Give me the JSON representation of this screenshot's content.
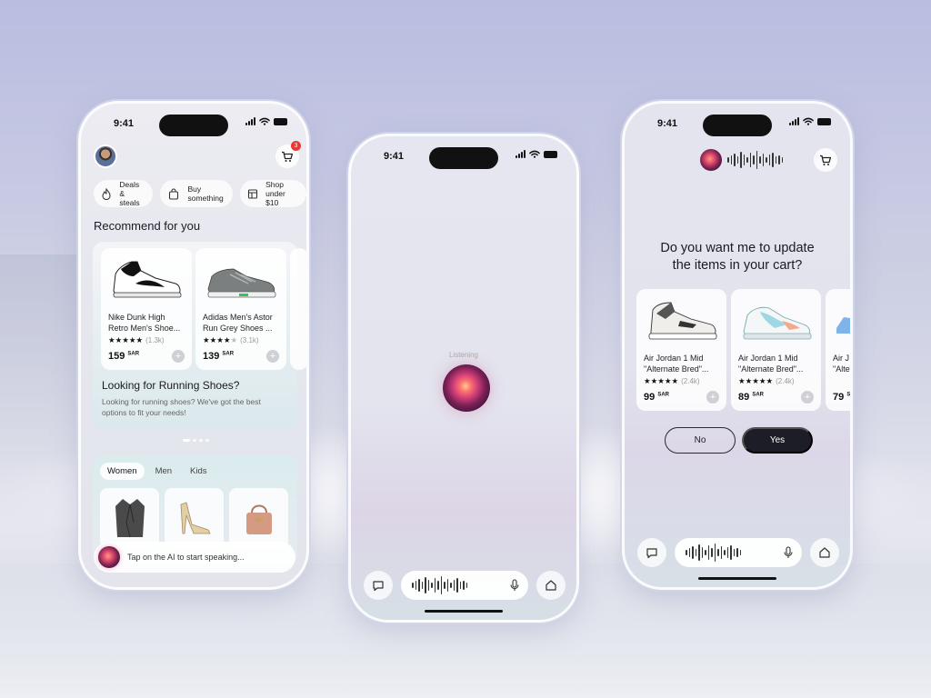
{
  "colors": {
    "accent": "#1c1d26",
    "badge": "#e53935",
    "star": "#111111"
  },
  "status": {
    "time": "9:41"
  },
  "home": {
    "cart_count": "3",
    "chips": [
      {
        "icon": "flame-icon",
        "label": "Deals &\nsteals"
      },
      {
        "icon": "bag-icon",
        "label": "Buy\nsomething"
      },
      {
        "icon": "store-icon",
        "label": "Shop\nunder $10"
      }
    ],
    "section_title": "Recommend for you",
    "products": [
      {
        "name": "Nike Dunk High\nRetro Men's Shoe...",
        "rating_count": "(1.3k)",
        "price": "159",
        "currency": "SAR",
        "rating": 5
      },
      {
        "name": "Adidas Men's Astor\nRun Grey Shoes ...",
        "rating_count": "(3.1k)",
        "price": "139",
        "currency": "SAR",
        "rating": 4
      }
    ],
    "promo_title": "Looking for Running Shoes?",
    "promo_desc": "Looking for running shoes? We've got the best options to fit your needs!",
    "tabs": [
      "Women",
      "Men",
      "Kids"
    ],
    "ai_prompt": "Tap on the AI to start speaking..."
  },
  "listening": {
    "label": "Listening"
  },
  "cart_confirm": {
    "question": "Do you want me to update\nthe items in your cart?",
    "items": [
      {
        "name": "Air Jordan 1 Mid\n\"Alternate Bred\"...",
        "rating_count": "(2.4k)",
        "price": "99",
        "currency": "SAR",
        "rating": 5
      },
      {
        "name": "Air Jordan 1 Mid\n\"Alternate Bred\"...",
        "rating_count": "(2.4k)",
        "price": "89",
        "currency": "SAR",
        "rating": 5
      },
      {
        "name": "Air J\n\"Alte",
        "rating_count": "",
        "price": "79",
        "currency": "S",
        "rating": 0
      }
    ],
    "no_label": "No",
    "yes_label": "Yes"
  }
}
